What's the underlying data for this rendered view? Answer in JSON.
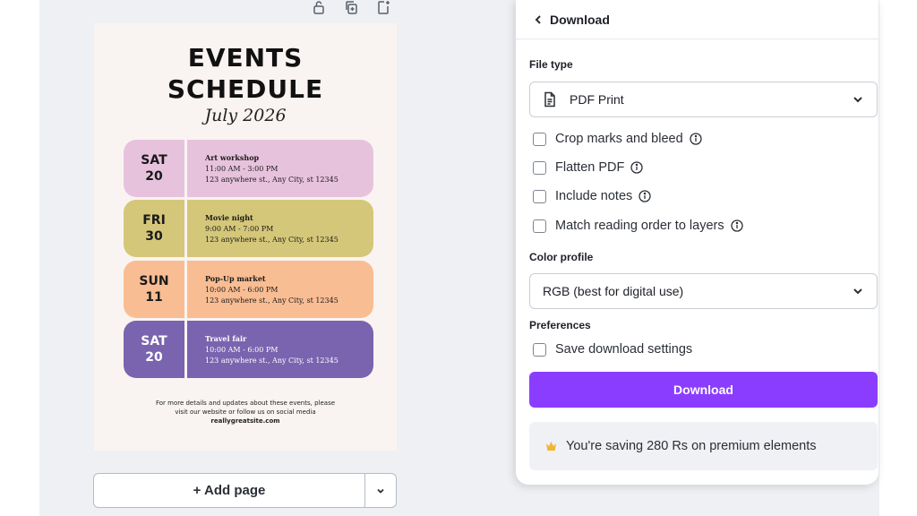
{
  "toolbar": {
    "icons": [
      "lock-icon",
      "duplicate-page-icon",
      "add-page-icon"
    ]
  },
  "poster": {
    "title_line1": "EVENTS",
    "title_line2": "SCHEDULE",
    "subtitle": "July 2026",
    "events": [
      {
        "weekday": "SAT",
        "day": "20",
        "name": "Art workshop",
        "time": "11:00 AM - 3:00 PM",
        "address": "123 anywhere st., Any City, st 12345",
        "day_color": "#e7c2dd",
        "info_color": "#e7c2dd"
      },
      {
        "weekday": "FRI",
        "day": "30",
        "name": "Movie night",
        "time": "9:00 AM - 7:00 PM",
        "address": "123 anywhere st., Any City, st 12345",
        "day_color": "#d5c779",
        "info_color": "#d5c779"
      },
      {
        "weekday": "SUN",
        "day": "11",
        "name": "Pop-Up market",
        "time": "10:00 AM - 6:00 PM",
        "address": "123 anywhere st., Any City, st 12345",
        "day_color": "#f9bd93",
        "info_color": "#f9bd93"
      },
      {
        "weekday": "SAT",
        "day": "20",
        "name": "Travel fair",
        "time": "10:00 AM - 6:00 PM",
        "address": "123 anywhere st., Any City, st 12345",
        "day_color": "#7a63af",
        "info_color": "#7a63af"
      }
    ],
    "footer_line1": "For more details and updates about these events, please",
    "footer_line2": "visit our website or follow us on social media",
    "footer_site": "reallygreatsite.com"
  },
  "add_page": {
    "label": "+ Add page"
  },
  "panel": {
    "title": "Download",
    "file_type_label": "File type",
    "file_type_value": "PDF Print",
    "options": [
      {
        "label": "Crop marks and bleed",
        "checked": false
      },
      {
        "label": "Flatten PDF",
        "checked": false
      },
      {
        "label": "Include notes",
        "checked": false
      },
      {
        "label": "Match reading order to layers",
        "checked": false
      }
    ],
    "color_profile_label": "Color profile",
    "color_profile_value": "RGB (best for digital use)",
    "preferences_label": "Preferences",
    "save_settings_label": "Save download settings",
    "download_button": "Download",
    "savings_text": "You're saving 280 Rs on premium elements"
  },
  "colors": {
    "accent": "#8b3dff",
    "canvas_bg": "#eef0f3",
    "poster_bg": "#f9f4f1",
    "premium_crown": "#f2b634"
  }
}
